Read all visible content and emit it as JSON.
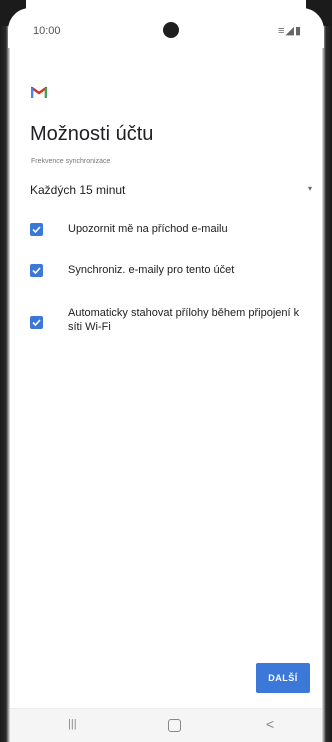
{
  "status_bar": {
    "time": "10:00",
    "icons": "☰ ▲ ▮"
  },
  "app": {
    "logo": "gmail-logo"
  },
  "page": {
    "title": "Možnosti účtu",
    "frequency_label": "Frekvence synchronizace",
    "frequency_value": "Každých 15 minut"
  },
  "options": [
    {
      "label": "Upozornit mě na příchod e-mailu",
      "checked": true
    },
    {
      "label": "Synchroniz. e-maily pro tento účet",
      "checked": true
    },
    {
      "label": "Automaticky stahovat přílohy během připojení k síti Wi-Fi",
      "checked": true
    }
  ],
  "actions": {
    "next_label": "DALŠÍ"
  },
  "navigation": {
    "recents": "|||",
    "back": "<"
  },
  "colors": {
    "accent": "#3c78d8",
    "gmail_red": "#d93025"
  }
}
